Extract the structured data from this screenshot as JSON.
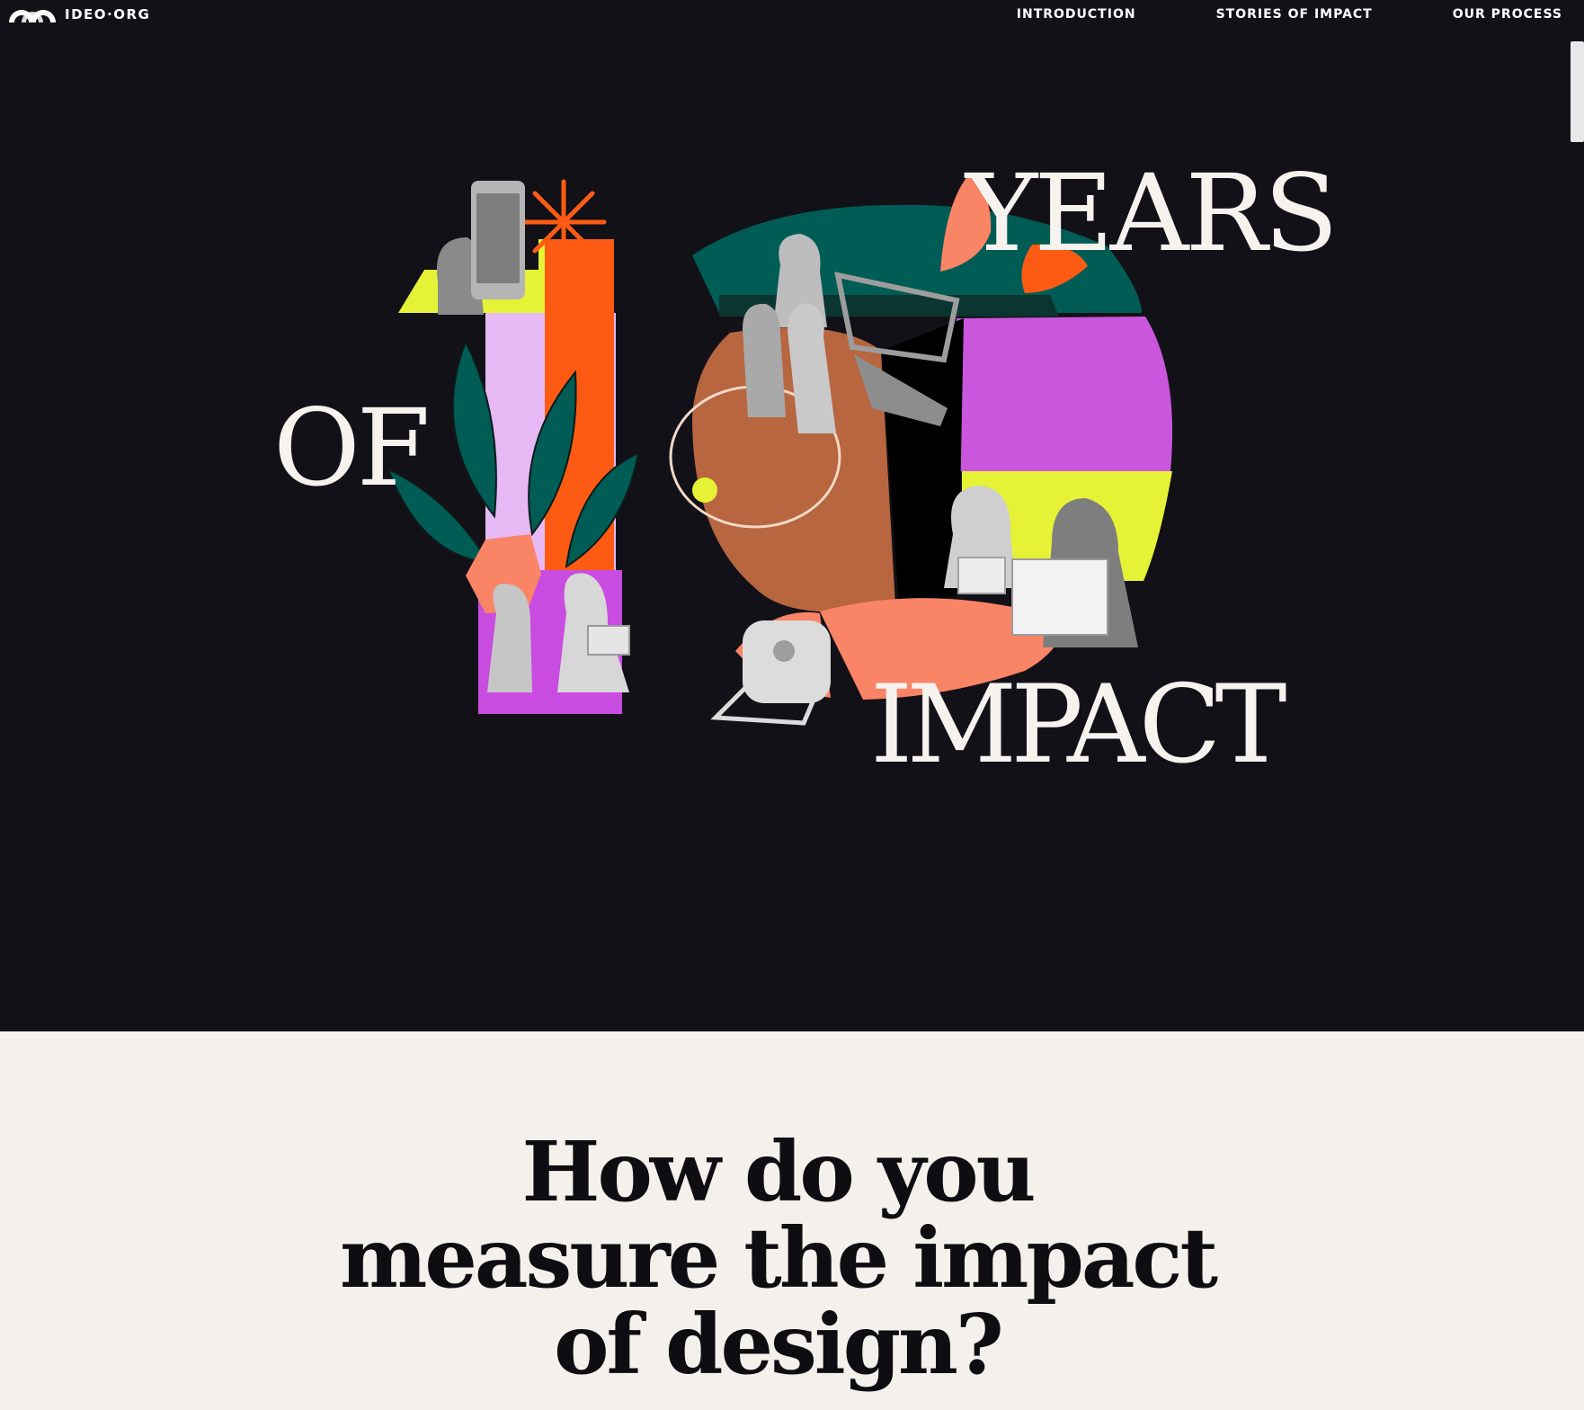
{
  "header": {
    "logo_text": "IDEO·ORG",
    "nav": [
      {
        "label": "INTRODUCTION"
      },
      {
        "label": "STORIES OF IMPACT"
      },
      {
        "label": "OUR PROCESS"
      }
    ]
  },
  "hero": {
    "word_years": "YEARS",
    "word_of": "OF",
    "word_impact": "IMPACT"
  },
  "question": {
    "lines": [
      "How do you",
      "measure the impact",
      "of design?"
    ]
  }
}
